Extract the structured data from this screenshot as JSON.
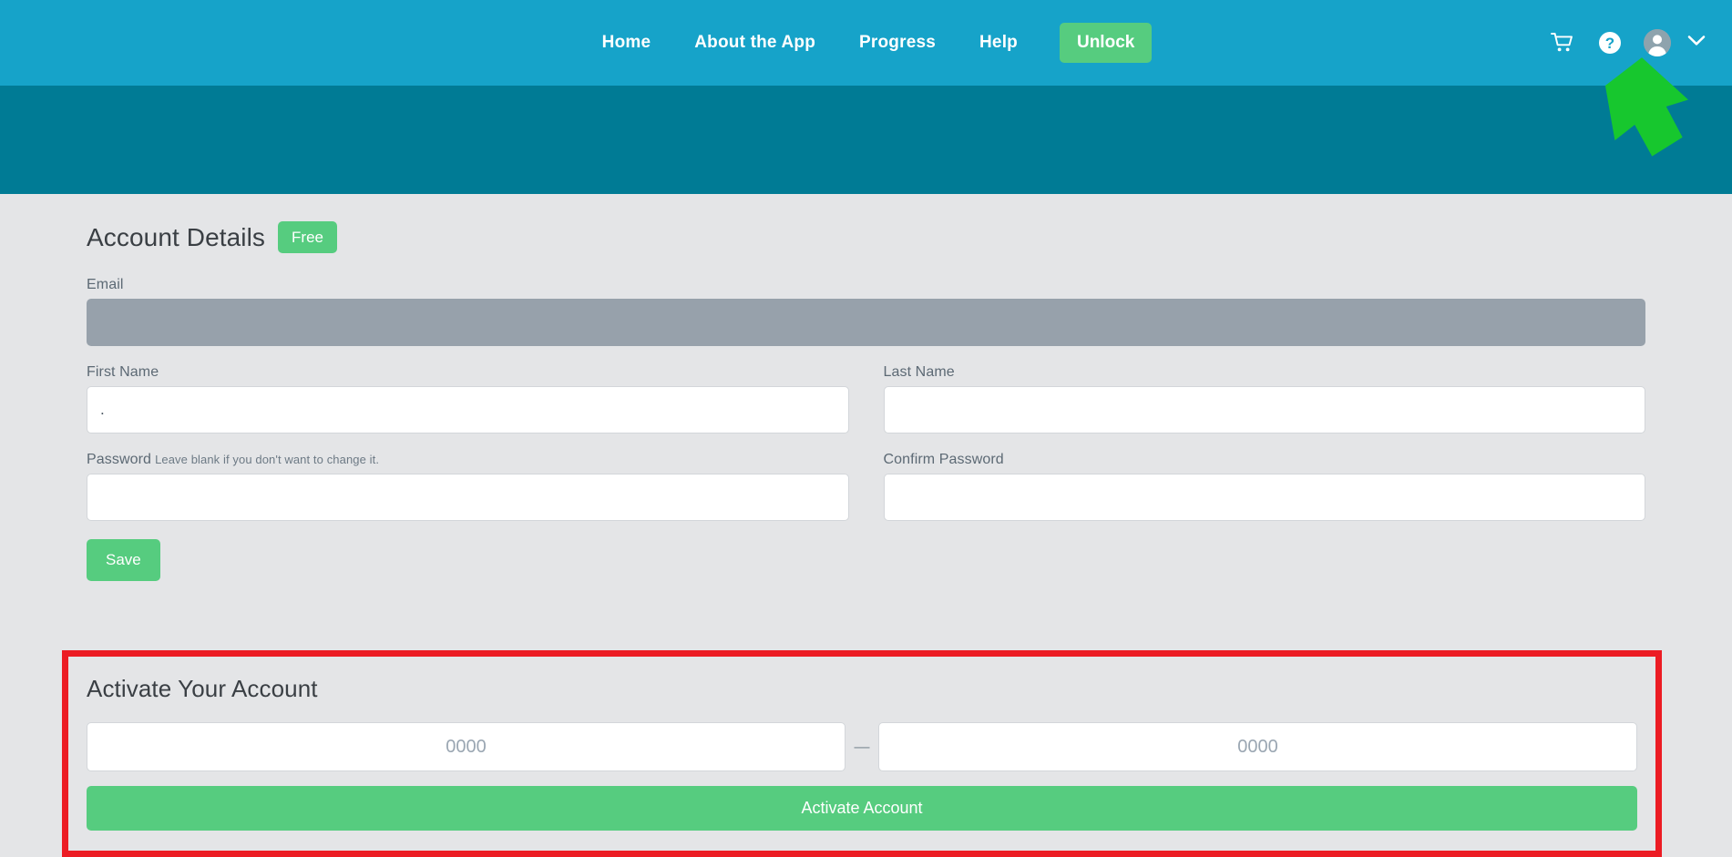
{
  "nav": {
    "links": [
      {
        "label": "Home",
        "name": "nav-link-home"
      },
      {
        "label": "About the App",
        "name": "nav-link-about-the-app"
      },
      {
        "label": "Progress",
        "name": "nav-link-progress"
      },
      {
        "label": "Help",
        "name": "nav-link-help"
      }
    ],
    "unlock_label": "Unlock",
    "icons": {
      "cart": "cart-icon",
      "help": "help-circle-icon",
      "avatar": "user-avatar-icon",
      "caret": "chevron-down-icon"
    }
  },
  "account": {
    "title": "Account Details",
    "plan_badge": "Free",
    "email": {
      "label": "Email",
      "value": "",
      "placeholder": ""
    },
    "first_name": {
      "label": "First Name",
      "value": ".",
      "placeholder": ""
    },
    "last_name": {
      "label": "Last Name",
      "value": "",
      "placeholder": ""
    },
    "password": {
      "label": "Password",
      "hint": "Leave blank if you don't want to change it.",
      "value": "",
      "placeholder": ""
    },
    "confirm_password": {
      "label": "Confirm Password",
      "value": "",
      "placeholder": ""
    },
    "save_label": "Save"
  },
  "activate": {
    "title": "Activate Your Account",
    "code_part1": {
      "value": "",
      "placeholder": "0000"
    },
    "separator": "—",
    "code_part2": {
      "value": "",
      "placeholder": "0000"
    },
    "button_label": "Activate Account"
  },
  "annotations": {
    "highlight_box_color": "#ec1c24",
    "arrow_color": "#17c72e"
  },
  "colors": {
    "nav_background": "#16a3c9",
    "hero_background": "#007b95",
    "page_background": "#e4e5e7",
    "accent_green": "#56cc7f",
    "disabled_field": "#97a1ab"
  }
}
